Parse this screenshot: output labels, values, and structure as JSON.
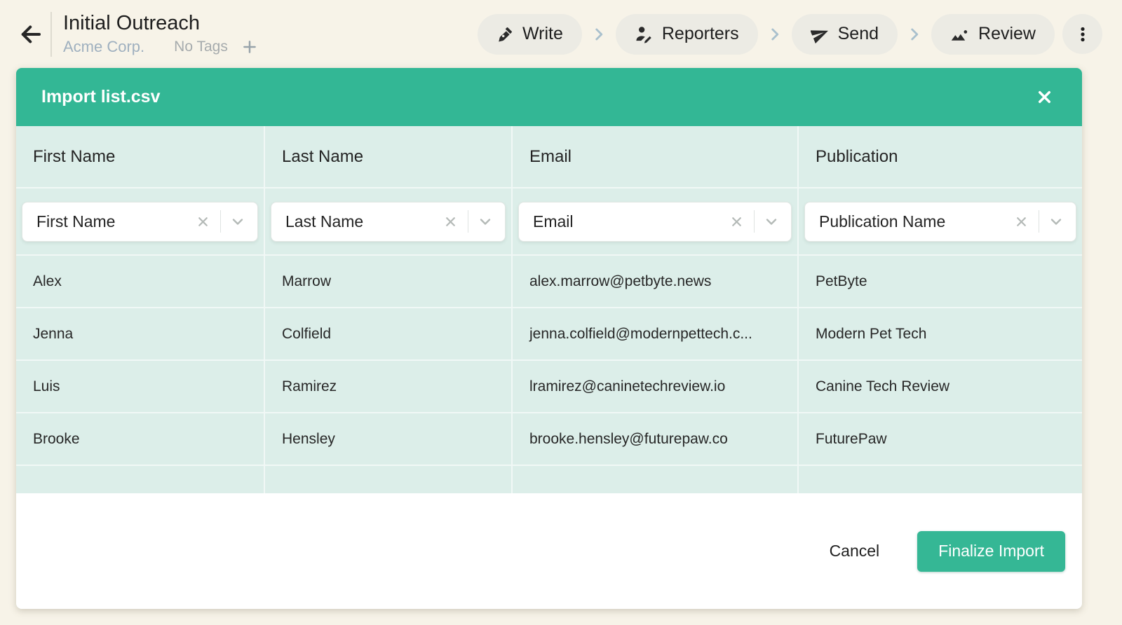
{
  "colors": {
    "page_bg": "#f7f3e8",
    "pill_bg": "#ecebe4",
    "accent_teal": "#33b795",
    "table_mint": "#dceee9",
    "muted_blue": "#9fb0bf",
    "muted_gray": "#a6abad"
  },
  "header": {
    "back_icon": "arrow-left-icon",
    "title": "Initial Outreach",
    "subtitle": "Acme Corp.",
    "tags_label": "No Tags",
    "add_tag_icon": "plus-icon",
    "steps": [
      {
        "label": "Write",
        "icon": "pen-nib-icon"
      },
      {
        "label": "Reporters",
        "icon": "person-edit-icon"
      },
      {
        "label": "Send",
        "icon": "paper-plane-icon"
      },
      {
        "label": "Review",
        "icon": "image-icon"
      }
    ],
    "menu_icon": "kebab-menu-icon"
  },
  "modal": {
    "title": "Import list.csv",
    "close_icon": "close-icon",
    "columns": [
      {
        "header": "First Name",
        "mapping": "First Name"
      },
      {
        "header": "Last Name",
        "mapping": "Last Name"
      },
      {
        "header": "Email",
        "mapping": "Email"
      },
      {
        "header": "Publication",
        "mapping": "Publication Name"
      }
    ],
    "rows": [
      [
        "Alex",
        "Marrow",
        "alex.marrow@petbyte.news",
        "PetByte"
      ],
      [
        "Jenna",
        "Colfield",
        "jenna.colfield@modernpettech.c...",
        "Modern Pet Tech"
      ],
      [
        "Luis",
        "Ramirez",
        "lramirez@caninetechreview.io",
        "Canine Tech Review"
      ],
      [
        "Brooke",
        "Hensley",
        "brooke.hensley@futurepaw.co",
        "FuturePaw"
      ]
    ],
    "footer": {
      "cancel_label": "Cancel",
      "finalize_label": "Finalize Import"
    }
  }
}
